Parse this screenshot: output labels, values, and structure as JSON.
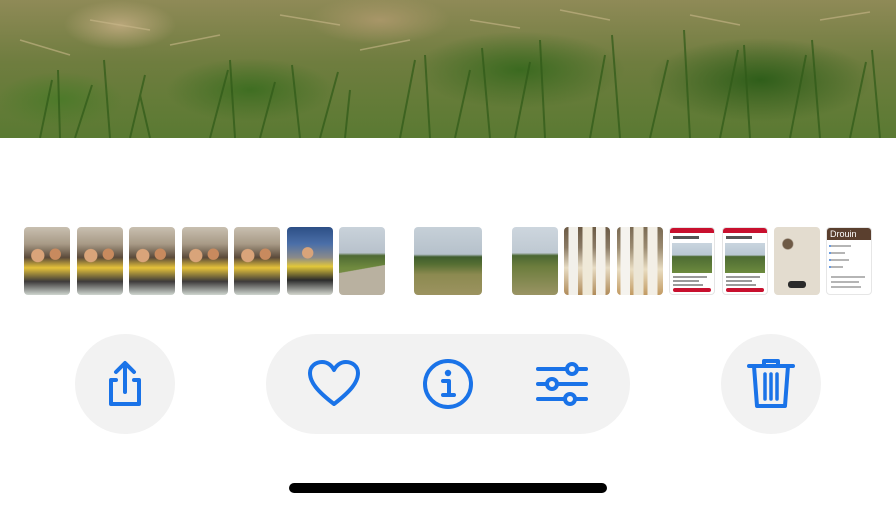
{
  "photo": {
    "subject": "grass-photo"
  },
  "filmstrip": {
    "thumbnails": [
      {
        "kind": "people"
      },
      {
        "kind": "people"
      },
      {
        "kind": "people"
      },
      {
        "kind": "people"
      },
      {
        "kind": "people"
      },
      {
        "kind": "people"
      },
      {
        "kind": "landscape"
      },
      {
        "kind": "landscape",
        "current": true
      },
      {
        "kind": "landscape"
      },
      {
        "kind": "bottles"
      },
      {
        "kind": "bottles"
      },
      {
        "kind": "listing-screenshot"
      },
      {
        "kind": "listing-screenshot"
      },
      {
        "kind": "pots"
      },
      {
        "kind": "document-screenshot",
        "header_text": "Drouin"
      }
    ]
  },
  "toolbar": {
    "share_icon": "share-icon",
    "favorite_icon": "heart-icon",
    "info_icon": "info-icon",
    "adjust_icon": "sliders-icon",
    "delete_icon": "trash-icon",
    "accent_color": "#1a73e8",
    "button_bg": "#f2f2f2"
  }
}
